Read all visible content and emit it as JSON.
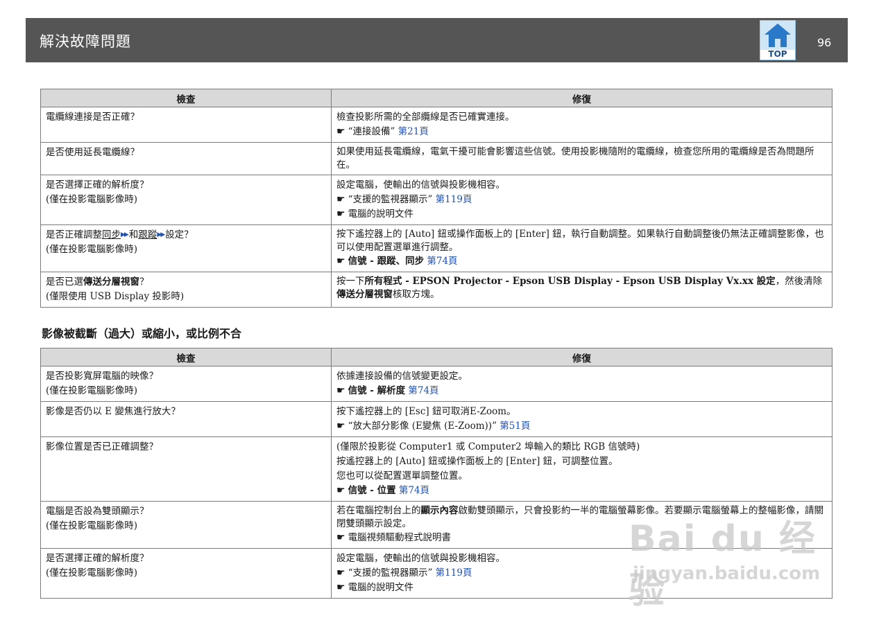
{
  "header": {
    "title": "解決故障問題",
    "top_label": "TOP",
    "page_number": "96"
  },
  "table1": {
    "headers": [
      "檢查",
      "修復"
    ],
    "rows": [
      {
        "check": [
          "電纜線連接是否正確？"
        ],
        "fix": {
          "text": "檢查投影所需的全部纜線是否已確實連接。",
          "ref_text": "“連接設備”",
          "ref_link": "第21頁"
        }
      },
      {
        "check": [
          "是否使用延長電纜線？"
        ],
        "fix": {
          "text": "如果使用延長電纜線，電氣干擾可能會影響這些信號。使用投影機隨附的電纜線，檢查您所用的電纜線是否為問題所在。"
        }
      },
      {
        "check": [
          "是否選擇正確的解析度？",
          "(僅在投影電腦影像時)"
        ],
        "fix": {
          "text": "設定電腦，使輸出的信號與投影機相容。",
          "ref_text": "“支援的監視器顯示”",
          "ref_link": "第119頁",
          "ref2": "電腦的說明文件"
        }
      },
      {
        "check_parts": [
          "是否正確調整",
          "同步",
          "和",
          "跟蹤",
          "設定？"
        ],
        "check_sub": "(僅在投影電腦影像時)",
        "fix": {
          "text": "按下遙控器上的 [Auto] 鈕或操作面板上的 [Enter] 鈕，執行自動調整。如果執行自動調整後仍無法正確調整影像，也可以使用配置選單進行調整。",
          "ref_text": "信號 - 跟蹤、同步",
          "ref_link": "第74頁"
        }
      },
      {
        "check_parts": [
          "是否已選",
          "傳送分層視窗",
          "？"
        ],
        "check_sub": "(僅限使用 USB Display 投影時)",
        "fix": {
          "parts": [
            "按一下",
            "所有程式 - EPSON Projector - Epson USB Display - Epson USB Display Vx.xx 設定",
            "，然後清除",
            "傳送分層視窗",
            "核取方塊。"
          ]
        }
      }
    ]
  },
  "section_heading": "影像被截斷（過大）或縮小，或比例不合",
  "table2": {
    "headers": [
      "檢查",
      "修復"
    ],
    "rows": [
      {
        "check": [
          "是否投影寬屏電腦的映像？",
          "(僅在投影電腦影像時)"
        ],
        "fix": {
          "text": "依據連接設備的信號變更設定。",
          "ref_text": "信號 - 解析度",
          "ref_link": "第74頁"
        }
      },
      {
        "check": [
          "影像是否仍以 E 變焦進行放大？"
        ],
        "fix": {
          "text": "按下遙控器上的 [Esc] 鈕可取消E-Zoom。",
          "ref_text": "“放大部分影像 (E變焦 (E-Zoom))”",
          "ref_link": "第51頁"
        }
      },
      {
        "check": [
          "影像位置是否已正確調整？"
        ],
        "fix": {
          "lines": [
            "(僅限於投影從 Computer1 或 Computer2 埠輸入的類比 RGB 信號時)",
            "按遙控器上的 [Auto] 鈕或操作面板上的 [Enter] 鈕，可調整位置。",
            "您也可以從配置選單調整位置。"
          ],
          "ref_text": "信號 - 位置",
          "ref_link": "第74頁"
        }
      },
      {
        "check": [
          "電腦是否設為雙頭顯示？",
          "(僅在投影電腦影像時)"
        ],
        "fix": {
          "parts": [
            "若在電腦控制台上的",
            "顯示內容",
            "啟動雙頭顯示，只會投影約一半的電腦螢幕影像。若要顯示電腦螢幕上的整幅影像，請關閉雙頭顯示設定。"
          ],
          "ref2": "電腦視頻驅動程式說明書"
        }
      },
      {
        "check": [
          "是否選擇正確的解析度？",
          "(僅在投影電腦影像時)"
        ],
        "fix": {
          "text": "設定電腦，使輸出的信號與投影機相容。",
          "ref_text": "“支援的監視器顯示”",
          "ref_link": "第119頁",
          "ref2": "電腦的說明文件"
        }
      }
    ]
  },
  "watermark": {
    "brand": "Bai du 经验",
    "url": "jingyan.baidu.com"
  },
  "colors": {
    "header_bg": "#555555",
    "table_header_bg": "#d9d9d9",
    "link": "#1f4fb0"
  }
}
